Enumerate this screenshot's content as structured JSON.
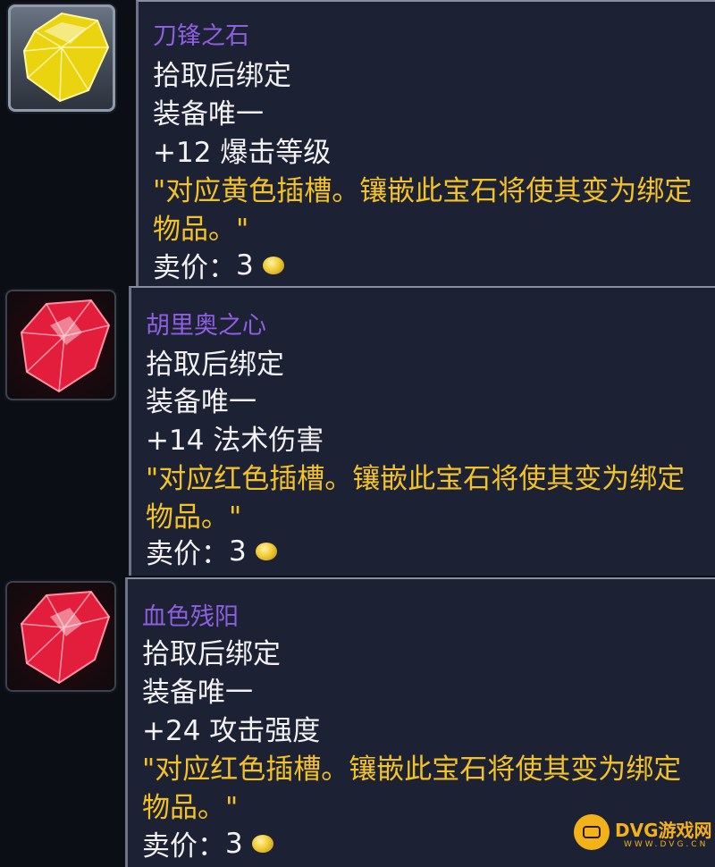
{
  "items": [
    {
      "gem_color": "yellow",
      "icon": "yellow-gem-icon",
      "name": "刀锋之石",
      "binding": "拾取后绑定",
      "unique": "装备唯一",
      "stat": "+12 爆击等级",
      "flavor_line1": "\"对应黄色插槽。镶嵌此宝石将使其变为绑定",
      "flavor_line2": "物品。\"",
      "price_label": "卖价：",
      "price_value": "3"
    },
    {
      "gem_color": "red",
      "icon": "red-gem-icon",
      "name": "胡里奥之心",
      "binding": "拾取后绑定",
      "unique": "装备唯一",
      "stat": "+14 法术伤害",
      "flavor_line1": "\"对应红色插槽。镶嵌此宝石将使其变为绑定",
      "flavor_line2": "物品。\"",
      "price_label": "卖价：",
      "price_value": "3"
    },
    {
      "gem_color": "red",
      "icon": "red-gem-icon",
      "name": "血色残阳",
      "binding": "拾取后绑定",
      "unique": "装备唯一",
      "stat": "+24 攻击强度",
      "flavor_line1": "\"对应红色插槽。镶嵌此宝石将使其变为绑定",
      "flavor_line2": "物品。\"",
      "price_label": "卖价：",
      "price_value": "3"
    }
  ],
  "colors": {
    "item_name": "#8e5fe0",
    "text_white": "#f2f2f2",
    "flavor_gold": "#f2c228",
    "tooltip_bg": "#1d2134"
  },
  "watermark": {
    "text": "DVG游戏网",
    "subtext": "WWW.DVG.CN",
    "icon": "gamepad-icon"
  }
}
